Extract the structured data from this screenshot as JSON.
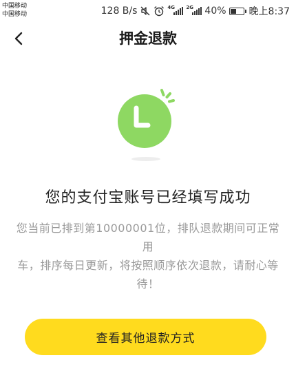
{
  "status_bar": {
    "carrier_1": "中国移动",
    "carrier_2": "中国移动",
    "network_speed": "128 B/s",
    "signal_1_label": "4G",
    "signal_2_label": "2G",
    "battery_percent": "40%",
    "battery_level": 0.4,
    "time": "晚上8:37",
    "icons": [
      "mute-icon",
      "alarm-icon",
      "signal-icon",
      "signal-icon",
      "battery-icon"
    ]
  },
  "header": {
    "title": "押金退款",
    "back_icon": "back-arrow-icon"
  },
  "illustration": {
    "icon": "clock-icon",
    "color": "#8ED862"
  },
  "main": {
    "heading": "您的支付宝账号已经填写成功",
    "description_line_1": "您当前已排到第10000001位，排队退款期间可正常用",
    "description_line_2": "车，排序每日更新，将按照顺序依次退款，请耐心等",
    "description_line_3": "待！"
  },
  "button": {
    "label": "查看其他退款方式",
    "color": "#FFDB1E"
  }
}
